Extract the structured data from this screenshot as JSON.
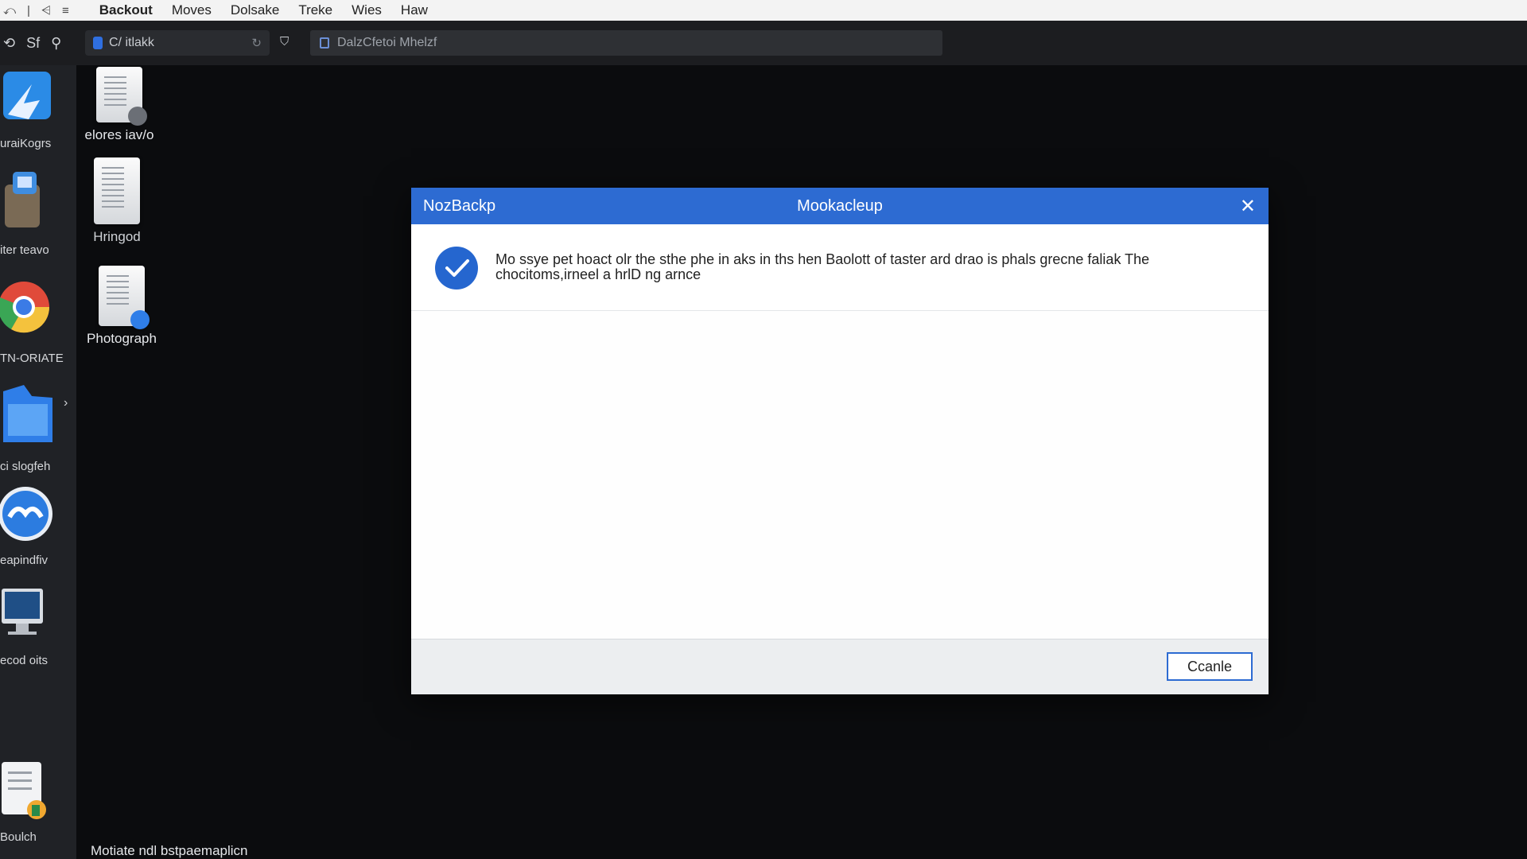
{
  "menubar": {
    "controls": [
      "⤺",
      "|",
      "⩤",
      "≡"
    ],
    "items": [
      "Backout",
      "Moves",
      "Dolsake",
      "Treke",
      "Wies",
      "Haw"
    ]
  },
  "toolbar": {
    "nav": [
      "⟲",
      "Sf",
      "⚲"
    ],
    "tab_title": "C/ itlakk",
    "address_text": "DalzCfetoi Mhelzf"
  },
  "dock": {
    "items": [
      {
        "label": "uraiKogrs",
        "icon": "finder-icon"
      },
      {
        "label": "iter teavo",
        "icon": "trash-icon"
      },
      {
        "label": "TN-ORIATE",
        "icon": "chrome-icon"
      },
      {
        "label": "ci slogfeh",
        "icon": "folder-icon"
      },
      {
        "label": "eapindfiv",
        "icon": "cloud-app-icon"
      },
      {
        "label": "ecod oits",
        "icon": "monitor-icon"
      },
      {
        "label": "Boulch",
        "icon": "document-icon"
      }
    ]
  },
  "desktop": {
    "icons": [
      {
        "label": "elores iav/o"
      },
      {
        "label": "Hringod"
      },
      {
        "label": "Photograph"
      }
    ],
    "bottom_text": "Motiate ndl bstpaemaplicn"
  },
  "dialog": {
    "title_left": "NozBackp",
    "title_center": "Mookacleup",
    "close_glyph": "✕",
    "message": "Mo ssye pet hoact olr the sthe phe in aks in ths hen Baolott of taster ard drao is phals grecne faliak The chocitoms,irneel a hrlD ng arnce",
    "button_label": "Ccanle"
  },
  "colors": {
    "accent": "#2d6bd2",
    "desktop_bg": "#0b0c0e"
  }
}
